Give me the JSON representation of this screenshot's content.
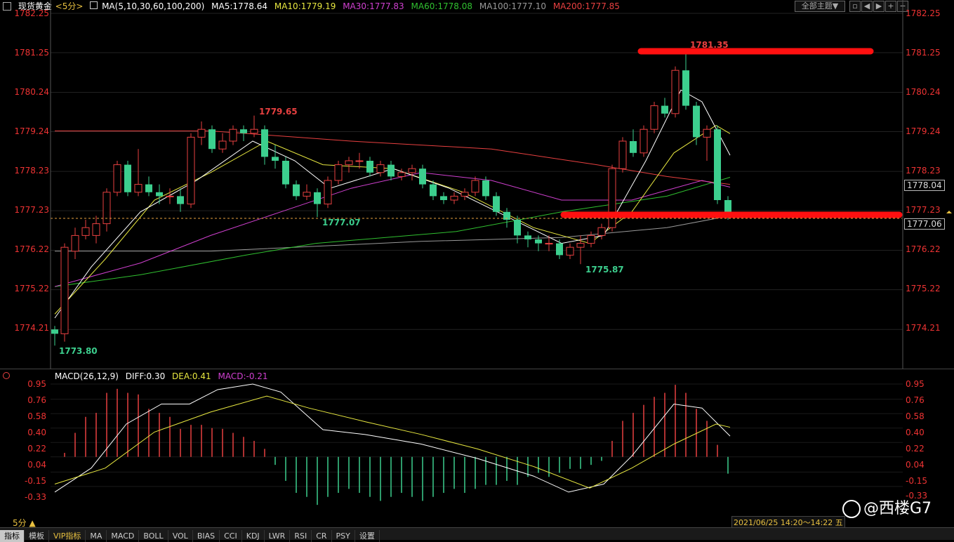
{
  "header": {
    "symbol": "现货黄金",
    "period": "<5分>",
    "ma_def": "MA(5,10,30,60,100,200)",
    "ma5": "MA5:1778.64",
    "ma10": "MA10:1779.19",
    "ma30": "MA30:1777.83",
    "ma60": "MA60:1778.08",
    "ma100": "MA100:1777.10",
    "ma200": "MA200:1777.85",
    "all_main": "全部主题▼"
  },
  "price_axis": [
    "1782.25",
    "1781.25",
    "1780.24",
    "1779.24",
    "1778.23",
    "1777.23",
    "1776.22",
    "1775.22",
    "1774.21"
  ],
  "price_tags": {
    "ma_tag": "1778.04",
    "last_tag": "1777.06"
  },
  "annotations": {
    "high": "1781.35",
    "low": "1775.87",
    "swing_high": "1779.65",
    "swing_low": "1777.07",
    "start_low": "1773.80"
  },
  "macd": {
    "label": "MACD(26,12,9)",
    "diff": "DIFF:0.30",
    "dea": "DEA:0.41",
    "macd": "MACD:-0.21",
    "axis": [
      "0.95",
      "0.76",
      "0.58",
      "0.40",
      "0.22",
      "0.04",
      "-0.15",
      "-0.33"
    ],
    "axis_right_last": "-0.33"
  },
  "period_button": "5分 ▲",
  "date_range": "2021/06/25 14:20～14:22 五",
  "watermark": "@西楼G7",
  "tabs": [
    "指标",
    "模板",
    "VIP指标",
    "MA",
    "MACD",
    "BOLL",
    "VOL",
    "BIAS",
    "CCI",
    "KDJ",
    "LWR",
    "RSI",
    "CR",
    "PSY",
    "设置"
  ],
  "colors": {
    "up": "#e84040",
    "down": "#3ccf8e",
    "ma5": "#ffffff",
    "ma10": "#e8e840",
    "ma30": "#d040d0",
    "ma60": "#30c030",
    "ma100": "#999999",
    "ma200": "#e84040",
    "level": "#ff1010"
  }
}
